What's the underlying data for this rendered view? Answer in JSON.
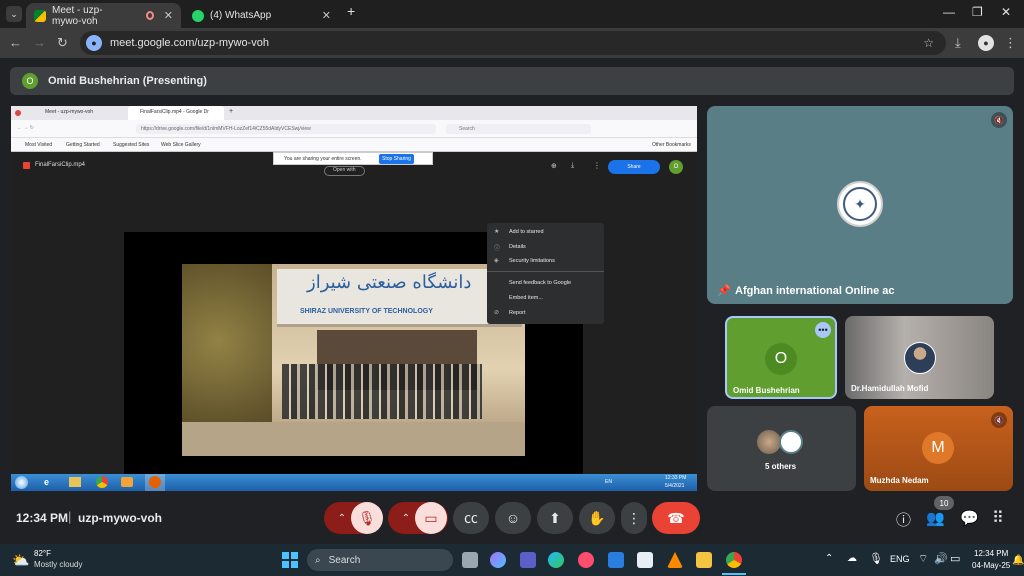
{
  "browser": {
    "tabs": [
      {
        "title": "Meet - uzp-mywo-voh",
        "active": true
      },
      {
        "title": "(4) WhatsApp",
        "active": false
      }
    ],
    "url": "meet.google.com/uzp-mywo-voh"
  },
  "meet": {
    "presenter_label": "Omid Bushehrian (Presenting)",
    "presenter_initial": "O",
    "shared_screen": {
      "ff_tabs": [
        "Meet - uzp-mywo-voh",
        "FinalFarsiClip.mp4 - Google Dr"
      ],
      "ff_url": "https://drive.google.com/file/d/1nlmMVFH-LozZef14iCZ55dAIdyVCESwj/view",
      "ff_search": "Search",
      "bookmarks": [
        "Most Visited",
        "Getting Started",
        "Suggested Sites",
        "Web Slice Gallery"
      ],
      "other_bookmarks": "Other Bookmarks",
      "sharing_notice": "You are sharing your entire screen.",
      "stop_sharing": "Stop Sharing",
      "file_name": "FinalFarsiClip.mp4",
      "open_with": "Open with",
      "share_label": "Share",
      "drive_avatar": "O",
      "menu_items": [
        "Add to starred",
        "Details",
        "Security limitations",
        "Send feedback to Google",
        "Embed item...",
        "Report"
      ],
      "sign_persian": "دانشگاه صنعتی شیراز",
      "sign_english": "SHIRAZ UNIVERSITY OF TECHNOLOGY",
      "taskbar_lang": "EN",
      "taskbar_time": "12:33 PM",
      "taskbar_date": "5/4/2021"
    },
    "tiles": {
      "main_name": "Afghan international Online ac",
      "omid_name": "Omid Bushehrian",
      "omid_initial": "O",
      "hamid_name": "Dr.Hamidullah Mofid",
      "others_label": "5 others",
      "muzhda_name": "Muzhda Nedam",
      "muzhda_initial": "M"
    },
    "bottom": {
      "time": "12:34 PM",
      "meeting_code": "uzp-mywo-voh",
      "participants_count": "10"
    }
  },
  "taskbar": {
    "weather_temp": "82°F",
    "weather_desc": "Mostly cloudy",
    "search_placeholder": "Search",
    "lang": "ENG",
    "time": "12:34 PM",
    "date": "04-May-25"
  },
  "colors": {
    "end_call": "#ea4335",
    "muted_btn": "#f9dedc",
    "omid_green": "#5f9e2f",
    "muzhda_orange": "#c8611d"
  }
}
